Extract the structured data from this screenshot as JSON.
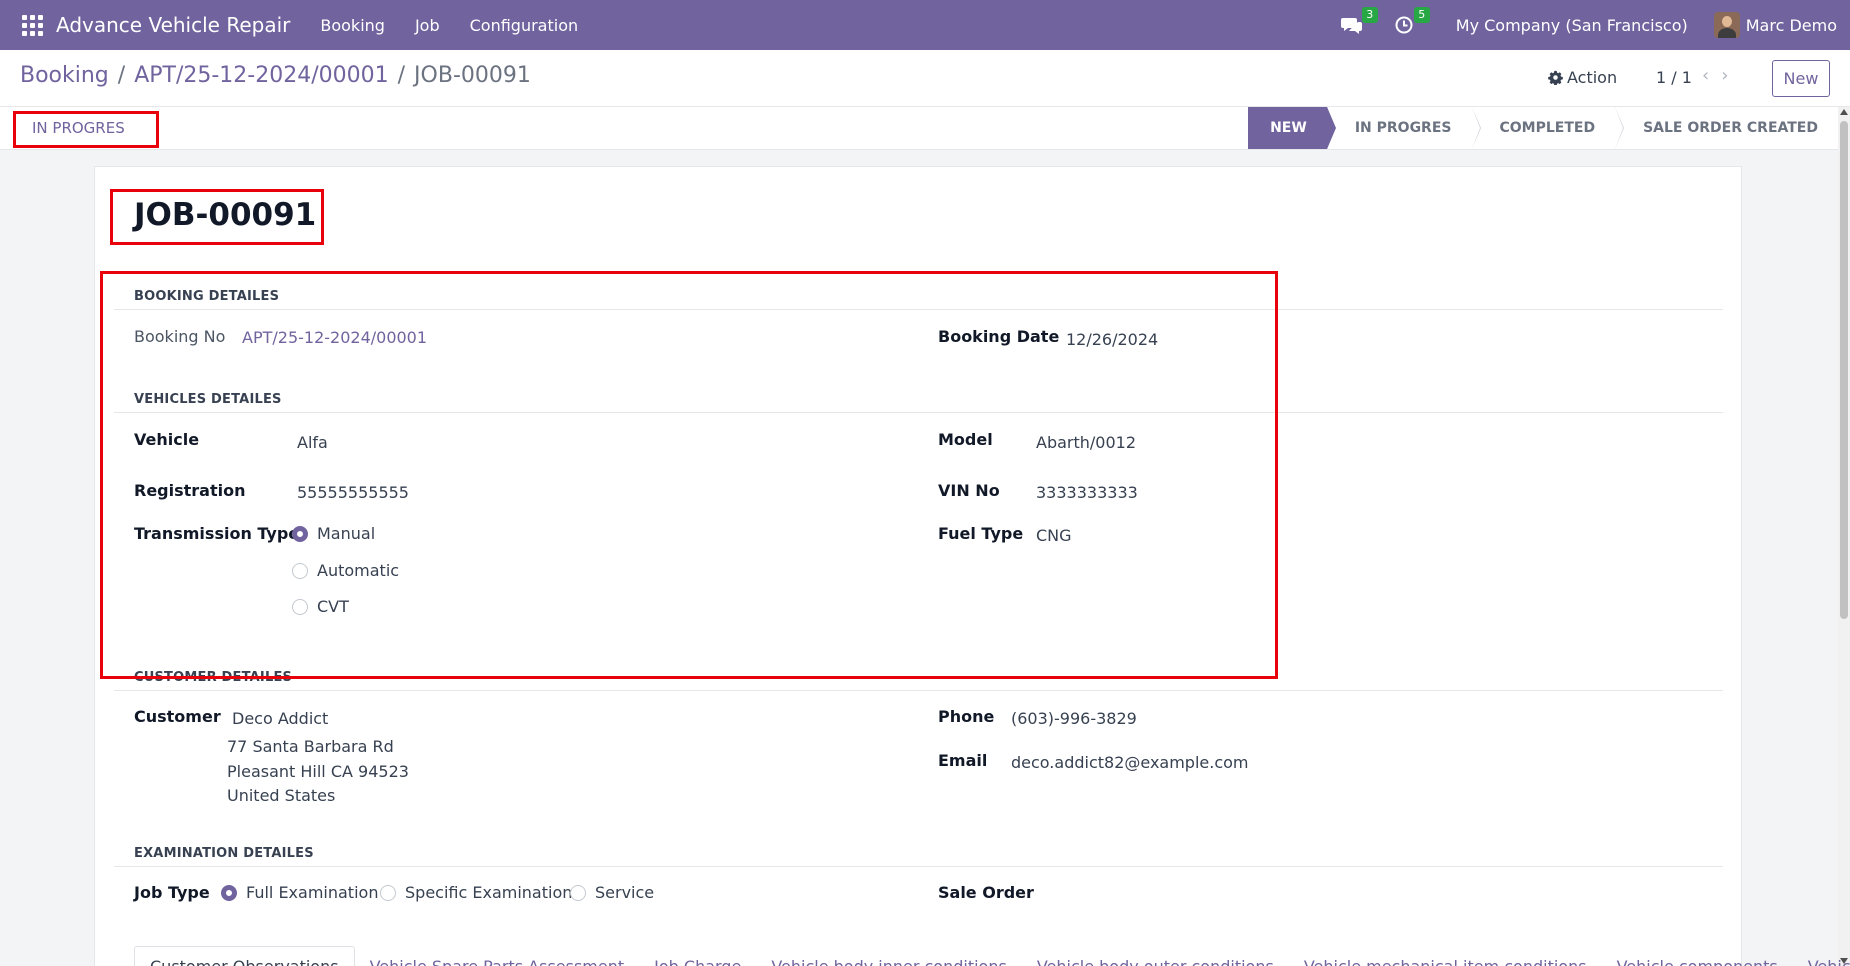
{
  "navbar": {
    "app_name": "Advance Vehicle Repair",
    "menu": [
      "Booking",
      "Job",
      "Configuration"
    ],
    "messages_count": "3",
    "activities_count": "5",
    "company": "My Company (San Francisco)",
    "user": "Marc Demo",
    "bg_color": "#71639e"
  },
  "control": {
    "breadcrumb": [
      "Booking",
      "APT/25-12-2024/00001",
      "JOB-00091"
    ],
    "action_label": "Action",
    "pager": "1 / 1",
    "new_label": "New"
  },
  "status": {
    "current_label": "IN PROGRES",
    "stages": [
      "NEW",
      "IN PROGRES",
      "COMPLETED",
      "SALE ORDER CREATED"
    ],
    "active_stage": "NEW"
  },
  "record": {
    "title": "JOB-00091",
    "booking": {
      "heading": "BOOKING DETAILES",
      "booking_no_label": "Booking No",
      "booking_no": "APT/25-12-2024/00001",
      "booking_date_label": "Booking Date",
      "booking_date": "12/26/2024"
    },
    "vehicle": {
      "heading": "VEHICLES DETAILES",
      "vehicle_label": "Vehicle",
      "vehicle": "Alfa",
      "model_label": "Model",
      "model": "Abarth/0012",
      "registration_label": "Registration",
      "registration": "55555555555",
      "vin_label": "VIN No",
      "vin": "3333333333",
      "transmission_label": "Transmission Type",
      "transmission_options": [
        "Manual",
        "Automatic",
        "CVT"
      ],
      "transmission_selected": "Manual",
      "fuel_label": "Fuel Type",
      "fuel": "CNG"
    },
    "customer": {
      "heading": "CUSTOMER DETAILES",
      "customer_label": "Customer",
      "name": "Deco Addict",
      "address_line1": "77 Santa Barbara Rd",
      "address_line2": "Pleasant Hill CA 94523",
      "address_line3": "United States",
      "phone_label": "Phone",
      "phone": "(603)-996-3829",
      "email_label": "Email",
      "email": "deco.addict82@example.com"
    },
    "examination": {
      "heading": "EXAMINATION DETAILES",
      "job_type_label": "Job Type",
      "job_type_options": [
        "Full Examination",
        "Specific Examination",
        "Service"
      ],
      "job_type_selected": "Full Examination",
      "sale_order_label": "Sale Order"
    },
    "tabs": [
      "Customer Observations",
      "Vehicle Spare Parts Assessment",
      "Job Charge",
      "Vehicle body inner conditions",
      "Vehicle body outer conditions",
      "Vehicle mechanical item conditions",
      "Vehicle components",
      "Vehicl"
    ]
  },
  "colors": {
    "accent": "#71639e",
    "highlight": "#e8000b"
  }
}
